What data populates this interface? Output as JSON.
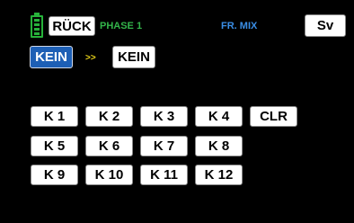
{
  "header": {
    "back_label": "RÜCK",
    "phase_label": "PHASE 1",
    "screen_title": "FR. MIX",
    "sv_label": "Sv"
  },
  "mix": {
    "from_value": "KEIN",
    "arrow": ">>",
    "to_value": "KEIN"
  },
  "switches": {
    "row1": [
      "K 1",
      "K 2",
      "K 3",
      "K 4"
    ],
    "clr_label": "CLR",
    "row2": [
      "K 5",
      "K 6",
      "K 7",
      "K 8"
    ],
    "row3": [
      "K 9",
      "K 10",
      "K 11",
      "K 12"
    ]
  },
  "colors": {
    "background": "#000000",
    "phase_text": "#33b44a",
    "title_text": "#3a8ee6",
    "arrow_text": "#e8d21a",
    "selected_button": "#1d5fb5",
    "battery": "#27b23a"
  }
}
